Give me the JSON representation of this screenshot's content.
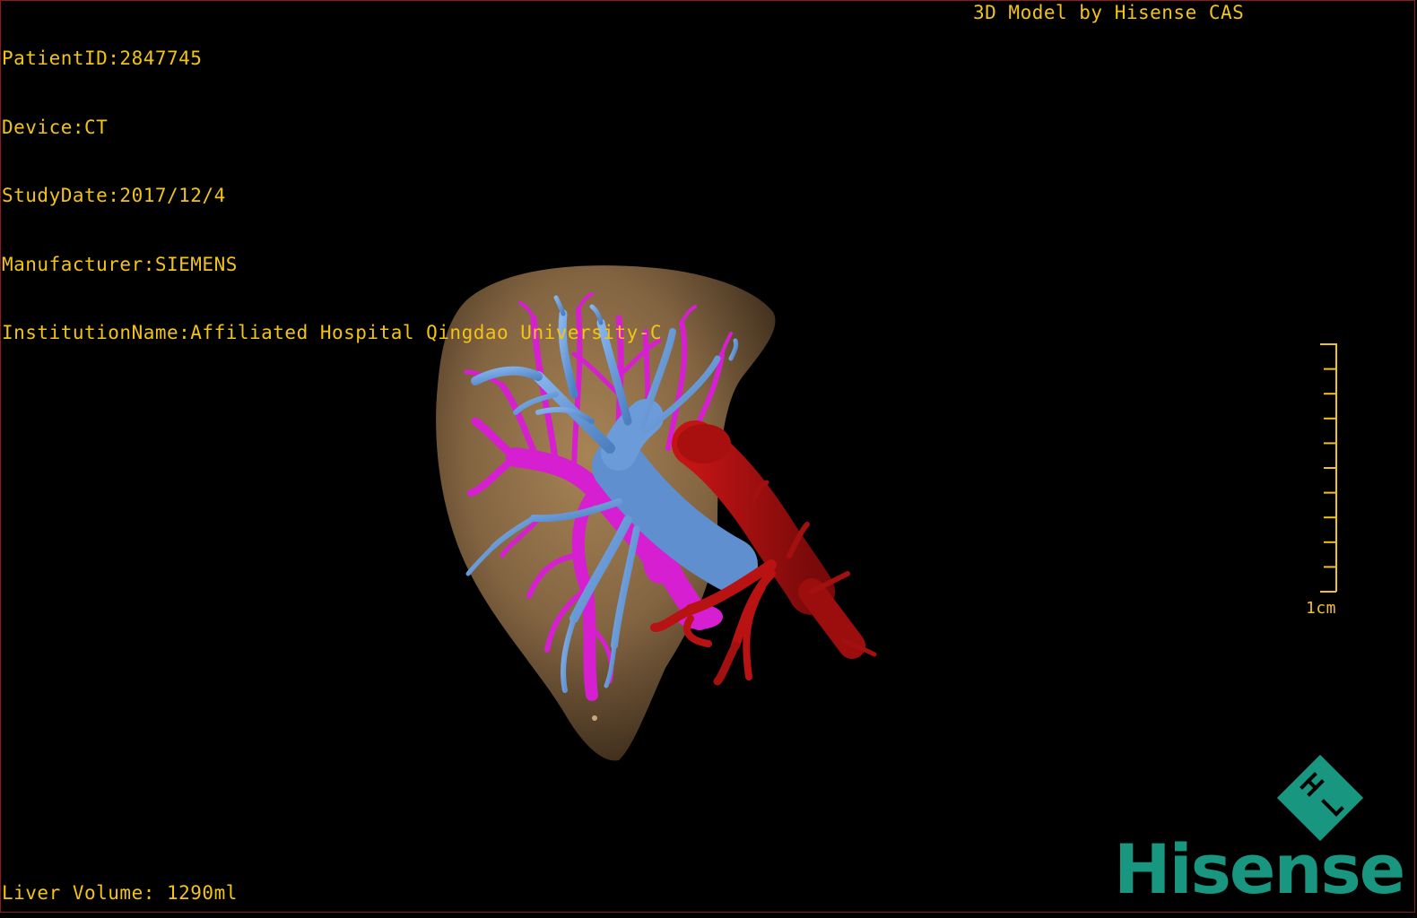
{
  "overlay": {
    "patient_id": "PatientID:2847745",
    "device": "Device:CT",
    "study_date": "StudyDate:2017/12/4",
    "manufacturer": "Manufacturer:SIEMENS",
    "institution": "InstitutionName:Affiliated Hospital Qingdao University-C",
    "credit": "3D Model by Hisense CAS",
    "liver_volume": "Liver Volume: 1290ml"
  },
  "scale_bar": {
    "label": "1cm",
    "tick_count": 10
  },
  "logo": {
    "brand": "Hisense",
    "color": "#18967f"
  },
  "colors": {
    "background": "#000000",
    "overlay_text": "#f2c318",
    "liver": "#8a6a45",
    "hepatic_vein": "#6a9ad6",
    "portal_vein": "#d51fd0",
    "artery": "#a80f0f",
    "frame": "#8b1a1a"
  },
  "model_parts": [
    "liver",
    "hepatic-veins",
    "portal-veins",
    "arteries"
  ]
}
